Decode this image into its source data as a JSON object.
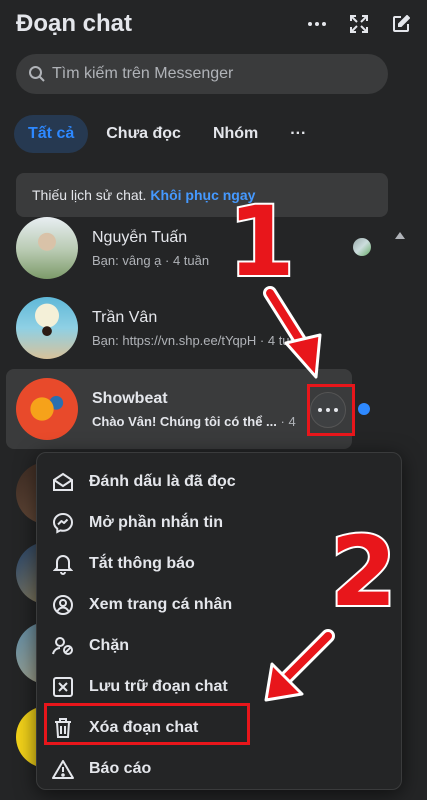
{
  "header": {
    "title": "Đoạn chat"
  },
  "search": {
    "placeholder": "Tìm kiếm trên Messenger"
  },
  "tabs": [
    {
      "label": "Tất cả"
    },
    {
      "label": "Chưa đọc"
    },
    {
      "label": "Nhóm"
    },
    {
      "label": "···"
    }
  ],
  "notice": {
    "text": "Thiếu lịch sử chat.",
    "link": "Khôi phục ngay"
  },
  "conversations": [
    {
      "name": "Nguyễn Tuấn",
      "preview": "Bạn: vâng ạ · 4 tuần"
    },
    {
      "name": "Trần Vân",
      "preview": "Bạn: https://vn.shp.ee/tYqpH · 4 tuần"
    },
    {
      "name": "Showbeat",
      "preview": "Chào Vân! Chúng tôi có thể ...",
      "time": "· 4"
    }
  ],
  "menu": {
    "items": [
      {
        "label": "Đánh dấu là đã đọc",
        "icon": "mark-read-icon"
      },
      {
        "label": "Mở phần nhắn tin",
        "icon": "messenger-icon"
      },
      {
        "label": "Tắt thông báo",
        "icon": "bell-icon"
      },
      {
        "label": "Xem trang cá nhân",
        "icon": "profile-icon"
      },
      {
        "label": "Chặn",
        "icon": "block-user-icon"
      },
      {
        "label": "Lưu trữ đoạn chat",
        "icon": "archive-icon"
      },
      {
        "label": "Xóa đoạn chat",
        "icon": "trash-icon"
      },
      {
        "label": "Báo cáo",
        "icon": "warning-icon"
      }
    ]
  },
  "annotations": {
    "step1": "1",
    "step2": "2"
  },
  "colors": {
    "accent": "#2d88ff",
    "annotation_red": "#e8161b",
    "background": "#242526"
  }
}
